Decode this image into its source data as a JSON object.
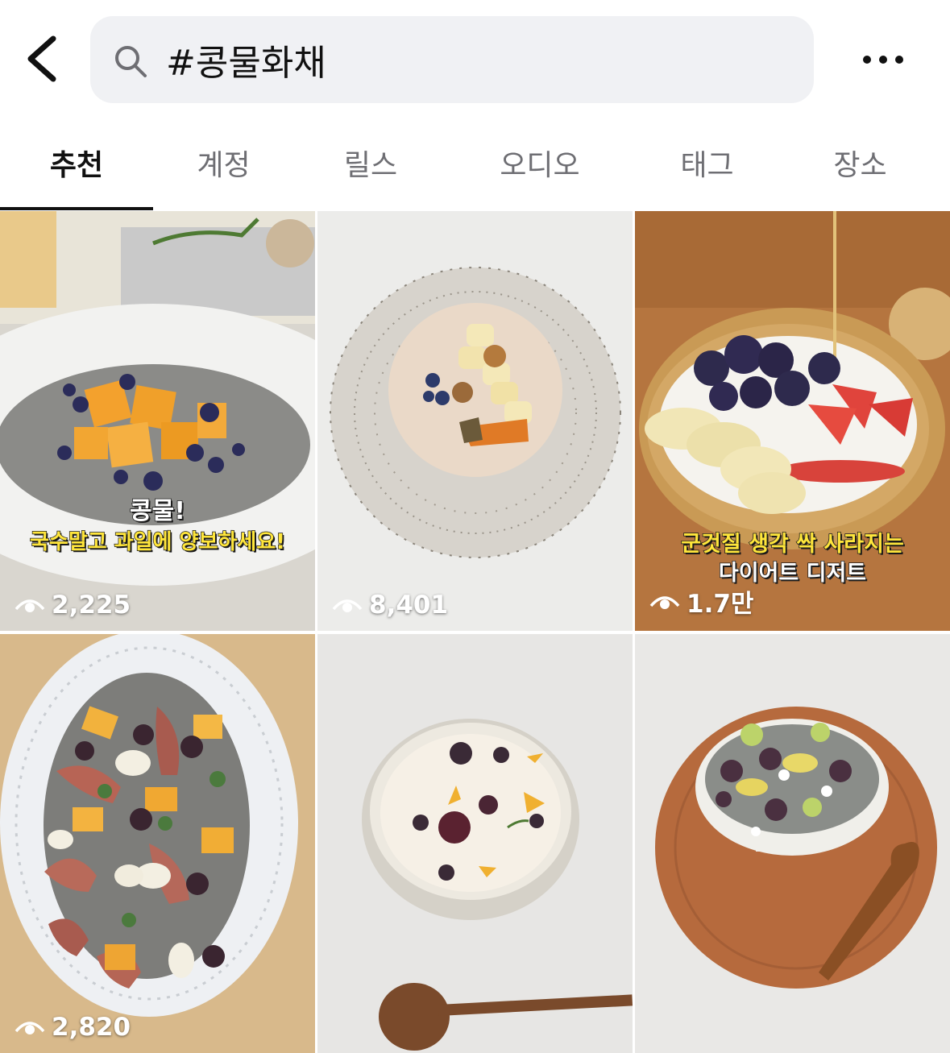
{
  "search": {
    "query": "#콩물화채"
  },
  "tabs": [
    {
      "label": "추천",
      "active": true
    },
    {
      "label": "계정",
      "active": false
    },
    {
      "label": "릴스",
      "active": false
    },
    {
      "label": "오디오",
      "active": false
    },
    {
      "label": "태그",
      "active": false
    },
    {
      "label": "장소",
      "active": false
    }
  ],
  "icons": {
    "back": "chevron-left-icon",
    "search": "search-icon",
    "more": "more-horizontal-icon",
    "views": "eye-icon"
  },
  "posts": [
    {
      "views": "2,225",
      "caption_line1": "콩물!",
      "caption_line2": "국수말고 과일에 양보하세요!"
    },
    {
      "views": "8,401"
    },
    {
      "views": "1.7만",
      "caption_line1": "군것질 생각 싹 사라지는",
      "caption_line2": "다이어트 디저트"
    },
    {
      "views": "2,820"
    },
    {},
    {}
  ]
}
